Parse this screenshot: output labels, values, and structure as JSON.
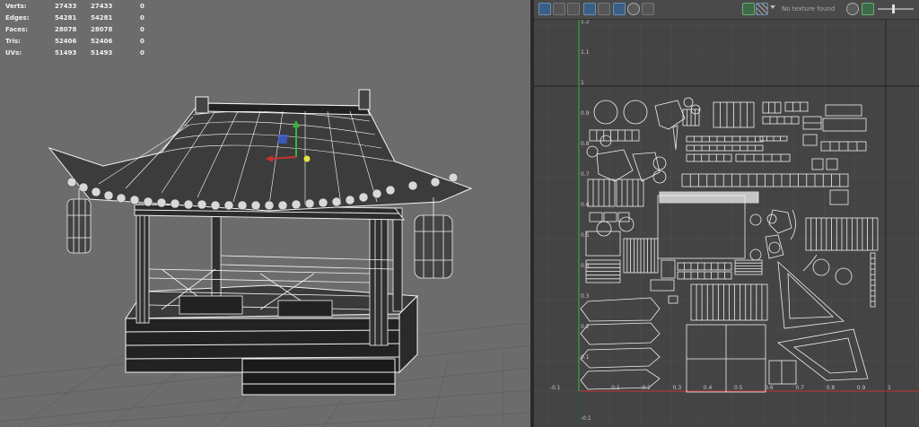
{
  "stats": {
    "rows": [
      {
        "label": "Verts:",
        "a": "27433",
        "b": "27433",
        "c": "0"
      },
      {
        "label": "Edges:",
        "a": "54281",
        "b": "54281",
        "c": "0"
      },
      {
        "label": "Faces:",
        "a": "28078",
        "b": "28078",
        "c": "0"
      },
      {
        "label": "Tris:",
        "a": "52406",
        "b": "52406",
        "c": "0"
      },
      {
        "label": "UVs:",
        "a": "51493",
        "b": "51493",
        "c": "0"
      }
    ]
  },
  "uv_editor": {
    "texture_status": "No texture found",
    "u_ticks": [
      "-0.1",
      "0.1",
      "0.2",
      "0.3",
      "0.4",
      "0.5",
      "0.6",
      "0.7",
      "0.8",
      "0.9",
      "1"
    ],
    "v_ticks": [
      "1.2",
      "1.1",
      "1",
      "0.9",
      "0.8",
      "0.7",
      "0.6",
      "0.5",
      "0.4",
      "0.3",
      "0.2",
      "0.1",
      "-0.1"
    ]
  },
  "toolbar_icons": [
    "uv-grid-icon",
    "uv-select-icon",
    "uv-shell-icon",
    "uv-frame-icon",
    "uv-checker-icon",
    "uv-snapshot-icon",
    "uv-isolate-icon",
    "uv-camera-icon",
    "texture-icon",
    "checker-pattern-icon",
    "dropdown-icon",
    "exposure-icon",
    "image-icon",
    "slider-icon"
  ],
  "colors": {
    "viewport_bg": "#6c6c6c",
    "uv_bg": "#444444",
    "accent_blue": "#3b5f84",
    "axis_red": "#c83232",
    "axis_green": "#3cb43c"
  }
}
